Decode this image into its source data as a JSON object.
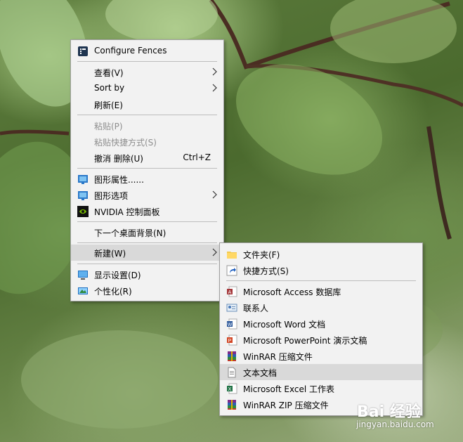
{
  "context_menu": {
    "items": [
      {
        "label": "Configure Fences",
        "icon": "fences-icon"
      },
      {
        "label": "查看(V)",
        "submenu": true
      },
      {
        "label": "Sort by",
        "submenu": true
      },
      {
        "label": "刷新(E)"
      },
      {
        "label": "粘贴(P)",
        "disabled": true
      },
      {
        "label": "粘贴快捷方式(S)",
        "disabled": true
      },
      {
        "label": "撤消 删除(U)",
        "shortcut": "Ctrl+Z"
      },
      {
        "label": "图形属性......",
        "icon": "intel-graphics-icon"
      },
      {
        "label": "图形选项",
        "icon": "intel-graphics-icon",
        "submenu": true
      },
      {
        "label": "NVIDIA 控制面板",
        "icon": "nvidia-icon"
      },
      {
        "label": "下一个桌面背景(N)"
      },
      {
        "label": "新建(W)",
        "submenu": true,
        "highlighted": true
      },
      {
        "label": "显示设置(D)",
        "icon": "display-icon"
      },
      {
        "label": "个性化(R)",
        "icon": "personalize-icon"
      }
    ]
  },
  "new_submenu": {
    "items": [
      {
        "label": "文件夹(F)",
        "icon": "folder-icon"
      },
      {
        "label": "快捷方式(S)",
        "icon": "shortcut-icon"
      },
      {
        "label": "Microsoft Access 数据库",
        "icon": "access-icon"
      },
      {
        "label": "联系人",
        "icon": "contact-icon"
      },
      {
        "label": "Microsoft Word 文档",
        "icon": "word-icon"
      },
      {
        "label": "Microsoft PowerPoint 演示文稿",
        "icon": "powerpoint-icon"
      },
      {
        "label": "WinRAR 压缩文件",
        "icon": "winrar-icon"
      },
      {
        "label": "文本文档",
        "icon": "text-document-icon",
        "highlighted": true
      },
      {
        "label": "Microsoft Excel 工作表",
        "icon": "excel-icon"
      },
      {
        "label": "WinRAR ZIP 压缩文件",
        "icon": "winrar-zip-icon"
      }
    ]
  },
  "watermark": {
    "brand": "Bai 经验",
    "url": "jingyan.baidu.com"
  },
  "colors": {
    "menu_bg": "#f2f2f2",
    "highlight": "#d9d9d9",
    "disabled_text": "#8e8e8e"
  }
}
